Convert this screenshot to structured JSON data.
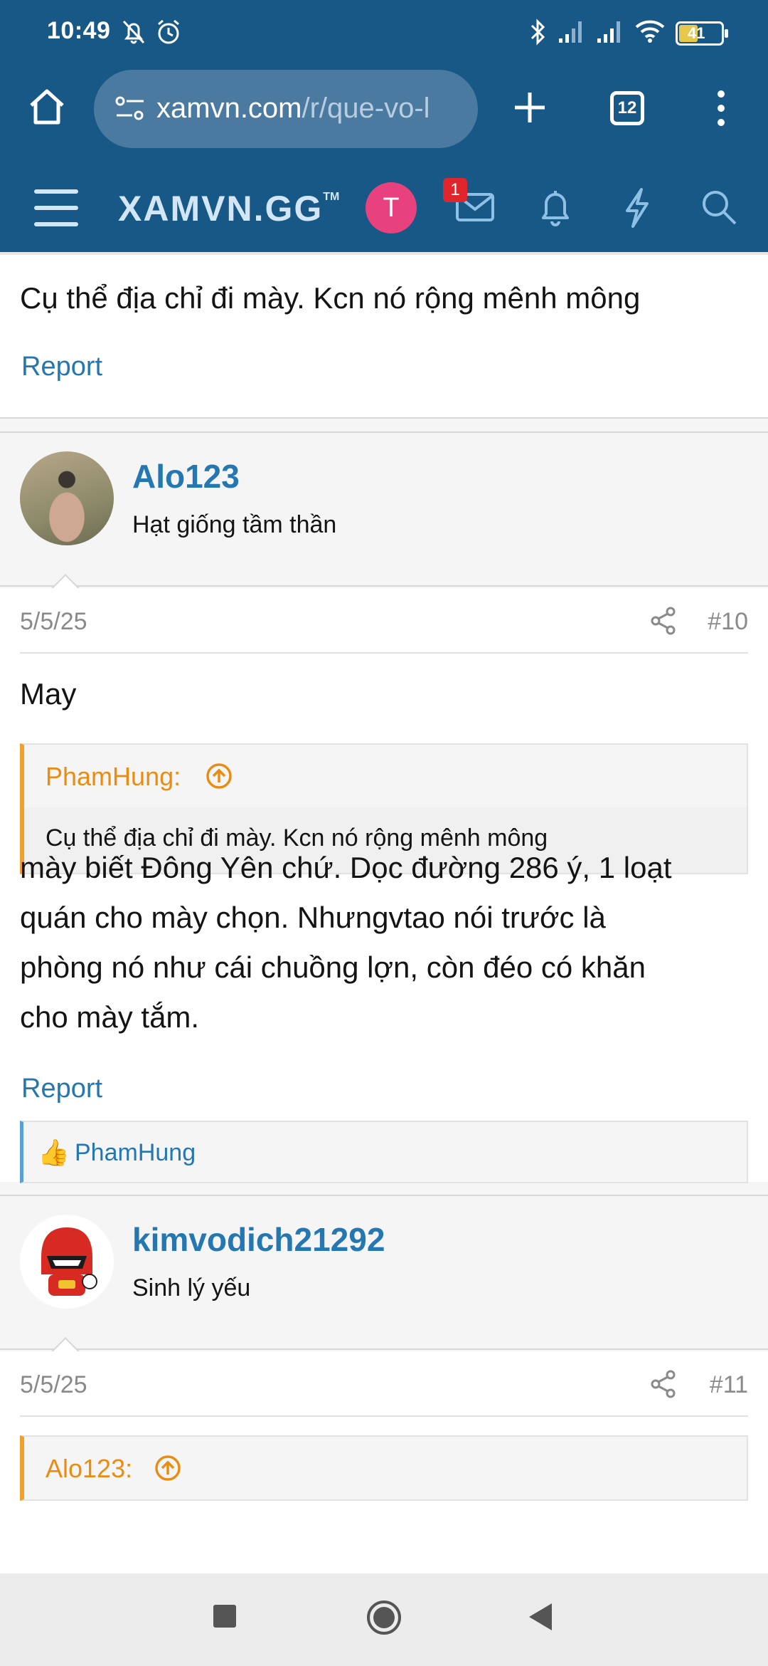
{
  "status": {
    "time": "10:49",
    "battery": "41"
  },
  "browser": {
    "url_host": "xamvn.com",
    "url_path": "/r/que-vo-l",
    "tab_count": "12"
  },
  "site": {
    "logo": "XAMVN.GG",
    "logo_tm": "TM",
    "user_initial": "T",
    "inbox_badge": "1"
  },
  "prev_post": {
    "text": "Cụ thể địa chỉ đi mày. Kcn nó rộng mênh mông",
    "report": "Report"
  },
  "post10": {
    "username": "Alo123",
    "user_title": "Hạt giống tầm thần",
    "date": "5/5/25",
    "number": "#10",
    "line1": "May",
    "quote_author": "PhamHung:",
    "quote_text": "Cụ thể địa chỉ đi mày. Kcn nó rộng mênh mông",
    "body": [
      "mày biết Đông Yên chứ. Dọc đường 286 ý, 1 loạt",
      "quán cho mày chọn. Nhưngvtao nói trước là",
      "phòng nó như cái chuồng lợn, còn đéo có khăn",
      "cho mày tắm."
    ],
    "report": "Report",
    "liked_by": "PhamHung"
  },
  "post11": {
    "username": "kimvodich21292",
    "user_title": "Sinh lý yếu",
    "date": "5/5/25",
    "number": "#11",
    "quote_author": "Alo123:"
  },
  "colors": {
    "header": "#185886",
    "link": "#2577b1",
    "quote_accent": "#f0a12b",
    "badge": "#e0262d",
    "avatar": "#e8427e"
  }
}
